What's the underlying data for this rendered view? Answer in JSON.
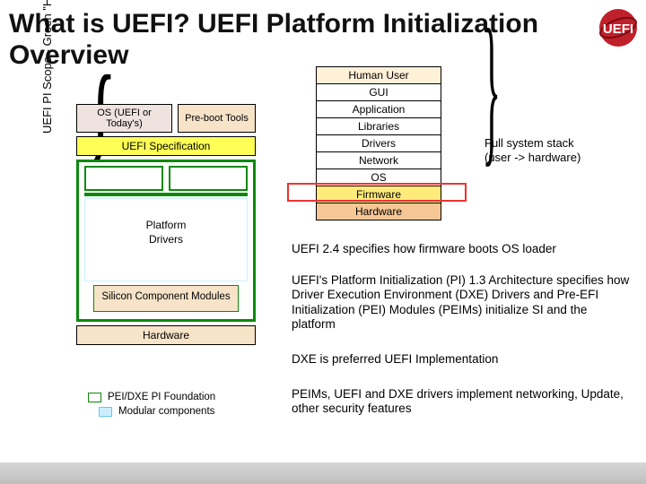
{
  "title": "What is UEFI? UEFI Platform Initialization Overview",
  "logo_alt": "UEFI logo",
  "left_diagram": {
    "os_box": "OS (UEFI or Today's)",
    "preboot_box": "Pre-boot Tools",
    "uefi_spec": "UEFI Specification",
    "platform_drivers_l1": "Platform",
    "platform_drivers_l2": "Drivers",
    "silicon_box": "Silicon Component Modules",
    "hardware": "Hardware"
  },
  "side_label": "UEFI PI Scope - Green \"H\"",
  "legend": {
    "green": "PEI/DXE PI Foundation",
    "cyan": "Modular components"
  },
  "stack": {
    "cells": [
      "Human User",
      "GUI",
      "Application",
      "Libraries",
      "Drivers",
      "Network",
      "OS",
      "Firmware",
      "Hardware"
    ],
    "caption_l1": "Full system stack",
    "caption_l2": "(user -> hardware)"
  },
  "paras": {
    "p1": "UEFI 2.4 specifies how firmware boots OS loader",
    "p2": "UEFI's Platform Initialization (PI) 1.3 Architecture specifies how Driver Execution Environment (DXE) Drivers and Pre-EFI Initialization (PEI) Modules (PEIMs) initialize SI and the platform",
    "p3": "DXE is preferred UEFI Implementation",
    "p4": "PEIMs, UEFI and DXE drivers implement networking, Update, other security features"
  }
}
